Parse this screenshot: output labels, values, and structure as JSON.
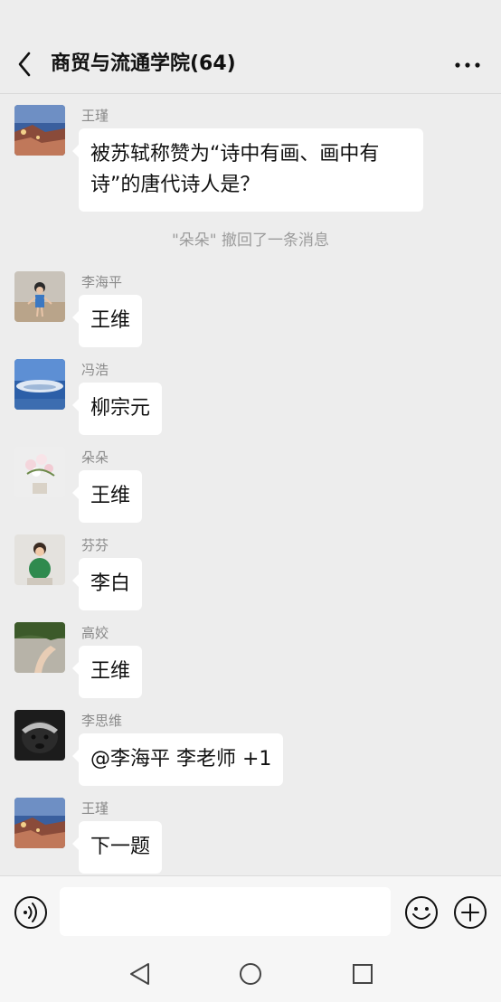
{
  "header": {
    "title": "商贸与流通学院(64)",
    "back_icon": "chevron-left-icon",
    "more_icon": "more-dots-icon"
  },
  "messages": [
    {
      "sender": "王瑾",
      "text_line1": "被苏轼称赞为“诗中有画、画中有",
      "text_line2": "诗”的唐代诗人是？"
    },
    {
      "sender": "李海平",
      "text": "王维"
    },
    {
      "sender": "冯浩",
      "text": "柳宗元"
    },
    {
      "sender": "朵朵",
      "text": "王维"
    },
    {
      "sender": "芬芬",
      "text": "李白"
    },
    {
      "sender": "高姣",
      "text": "王维"
    },
    {
      "sender": "李思维",
      "text": "@李海平 李老师 +1"
    },
    {
      "sender": "王瑾",
      "text": "下一题"
    }
  ],
  "system_notice": "\"朵朵\" 撤回了一条消息",
  "input": {
    "value": "",
    "voice_icon": "voice-icon",
    "emoji_icon": "emoji-icon",
    "plus_icon": "plus-icon"
  },
  "navbar": {
    "back_icon": "nav-back-icon",
    "home_icon": "nav-home-icon",
    "recent_icon": "nav-recent-icon"
  },
  "colors": {
    "background": "#ededed",
    "bubble": "#ffffff",
    "sender_name": "#8a8a8a",
    "system_text": "#9c9c9c"
  }
}
